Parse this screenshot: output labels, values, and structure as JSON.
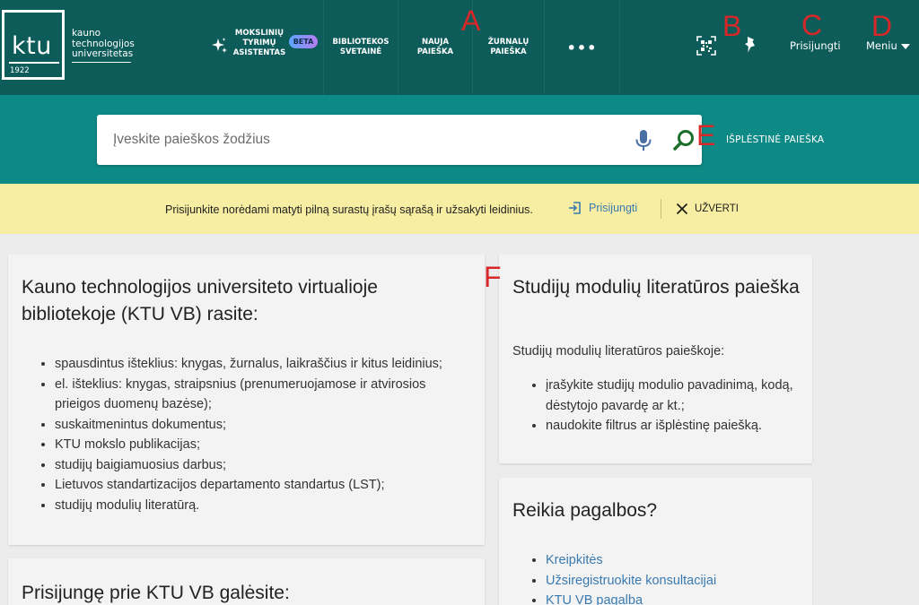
{
  "logo": {
    "mark": "ktu",
    "year": "1922",
    "name_lines": [
      "kauno",
      "technologijos",
      "universitetas"
    ]
  },
  "nav": {
    "ai": {
      "label": "Mokslinių tyrimų asistentas",
      "badge": "BETA",
      "icon": "sparkle-icon"
    },
    "libraries": "Bibliotekos svetainė",
    "new_search": "Nauja paieška",
    "journal_search": "Žurnalų paieška",
    "more": "•••"
  },
  "header_right": {
    "qr_icon": "qr-code-icon",
    "pin_icon": "pin-icon",
    "login": "Prisijungti",
    "menu": "Meniu"
  },
  "annotations": {
    "a": "A",
    "b": "B",
    "c": "C",
    "d": "D",
    "e": "E",
    "f": "F"
  },
  "search": {
    "placeholder": "Įveskite paieškos žodžius",
    "value": "",
    "advanced": "Išplėstinė paieška"
  },
  "notice": {
    "message": "Prisijunkite norėdami matyti pilną surastų įrašų sąrašą ir užsakyti leidinius.",
    "login": "Prisijungti",
    "close": "Užverti"
  },
  "card_vb": {
    "title": "Kauno technologijos universiteto virtualioje bibliotekoje (KTU VB) rasite:",
    "items": [
      "spausdintus išteklius: knygas, žurnalus, laikraščius ir kitus leidinius;",
      "el. išteklius: knygas, straipsnius (prenumeruojamose ir atvirosios prieigos duomenų bazėse);",
      "suskaitmenintus dokumentus;",
      "KTU mokslo publikacijas;",
      "studijų baigiamuosius darbus;",
      "Lietuvos standartizacijos departamento standartus (LST);",
      "studijų modulių literatūrą."
    ]
  },
  "card_modules": {
    "title": "Studijų modulių literatūros paieška",
    "intro": "Studijų modulių literatūros paieškoje:",
    "items": [
      "įrašykite studijų modulio pavadinimą, kodą, dėstytojo pavardę ar kt.;",
      "naudokite filtrus ar išplėstinę paiešką."
    ]
  },
  "card_help": {
    "title": "Reikia pagalbos?",
    "links": [
      "Kreipkitės",
      "Užsiregistruokite konsultacijai",
      "KTU VB pagalba"
    ]
  },
  "card_login": {
    "title": "Prisijungę prie KTU VB galėsite:"
  },
  "colors": {
    "header": "#0d5c5a",
    "search_band": "#0e8a86",
    "notice": "#f7eea3",
    "link": "#3a7ab0",
    "annotation": "#d62828"
  }
}
